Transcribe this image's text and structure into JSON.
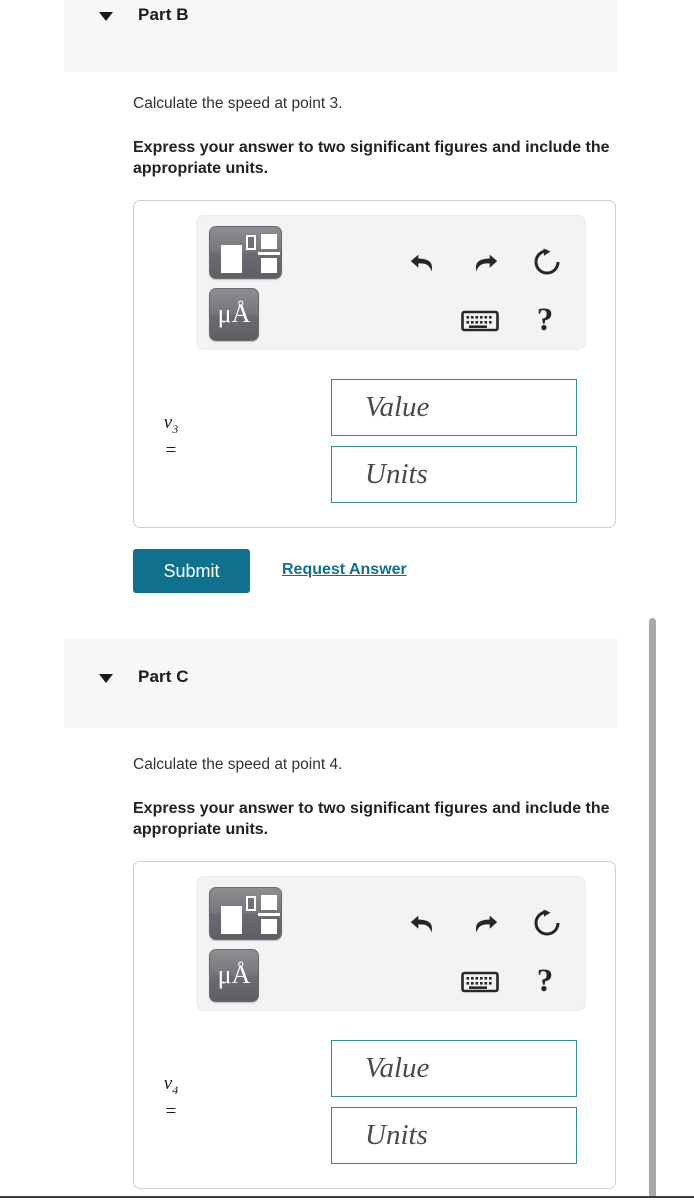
{
  "parts": [
    {
      "id": "part-b",
      "title": "Part B",
      "caret_icon": "caret-down-icon",
      "question": "Calculate the speed at point 3.",
      "instruction": "Express your answer to two significant figures and include the appropriate units.",
      "answer": {
        "toolbar": {
          "template_button_icon": "math-template-icon",
          "unit_button_label": "μÅ",
          "unit_button_icon": "units-icon",
          "undo_icon": "undo-arrow-icon",
          "redo_icon": "redo-arrow-icon",
          "reset_icon": "reset-circular-arrow-icon",
          "keyboard_icon": "keyboard-icon",
          "help_label": "?",
          "help_icon": "question-mark-icon"
        },
        "label_var": "v",
        "label_sub": "3",
        "label_eq": "=",
        "value_placeholder": "Value",
        "units_placeholder": "Units",
        "value_text": "",
        "units_text": ""
      },
      "actions": {
        "submit_label": "Submit",
        "request_answer_label": "Request Answer"
      }
    },
    {
      "id": "part-c",
      "title": "Part C",
      "caret_icon": "caret-down-icon",
      "question": "Calculate the speed at point 4.",
      "instruction": "Express your answer to two significant figures and include the appropriate units.",
      "answer": {
        "toolbar": {
          "template_button_icon": "math-template-icon",
          "unit_button_label": "μÅ",
          "unit_button_icon": "units-icon",
          "undo_icon": "undo-arrow-icon",
          "redo_icon": "redo-arrow-icon",
          "reset_icon": "reset-circular-arrow-icon",
          "keyboard_icon": "keyboard-icon",
          "help_label": "?",
          "help_icon": "question-mark-icon"
        },
        "label_var": "v",
        "label_sub": "4",
        "label_eq": "=",
        "value_placeholder": "Value",
        "units_placeholder": "Units",
        "value_text": "",
        "units_text": ""
      },
      "actions": null
    }
  ],
  "colors": {
    "accent_teal": "#10718f",
    "field_border_teal": "#3a8798",
    "header_band": "#f7f7f7",
    "toolbar_panel": "#f3f3f3",
    "button_gray": "#6b6b71",
    "scrollbar_thumb": "#a8a8a8"
  },
  "scrollbar": {
    "name": "vertical-scrollbar"
  }
}
